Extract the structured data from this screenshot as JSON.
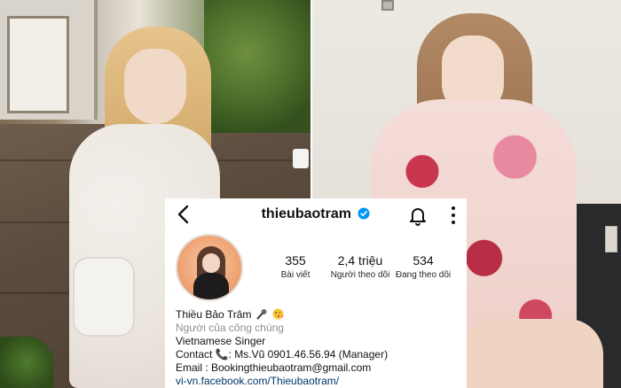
{
  "profile": {
    "username": "thieubaotram",
    "display_name": "Thiều Bảo Trâm",
    "category": "Người của công chúng",
    "bio_lines": [
      "Vietnamese Singer",
      "Contact 📞: Ms.Vũ 0901.46.56.94 (Manager)",
      "Email : Bookingthieubaotram@gmail.com"
    ],
    "link": "vi-vn.facebook.com/Thieubaotram/",
    "verified": true
  },
  "stats": {
    "posts": {
      "value": "355",
      "label": "Bài viết"
    },
    "followers": {
      "value": "2,4 triệu",
      "label": "Người theo dõi"
    },
    "following": {
      "value": "534",
      "label": "Đang theo dõi"
    }
  },
  "icons": {
    "back": "chevron-left-icon",
    "verified": "verified-badge-icon",
    "notifications": "bell-icon",
    "more": "more-vertical-icon",
    "name_emoji_1": "microphone-icon",
    "name_emoji_2": "kiss-face-icon"
  },
  "colors": {
    "verified_blue": "#0095f6",
    "link_blue": "#00376b",
    "muted_text": "#8e8e8e"
  }
}
